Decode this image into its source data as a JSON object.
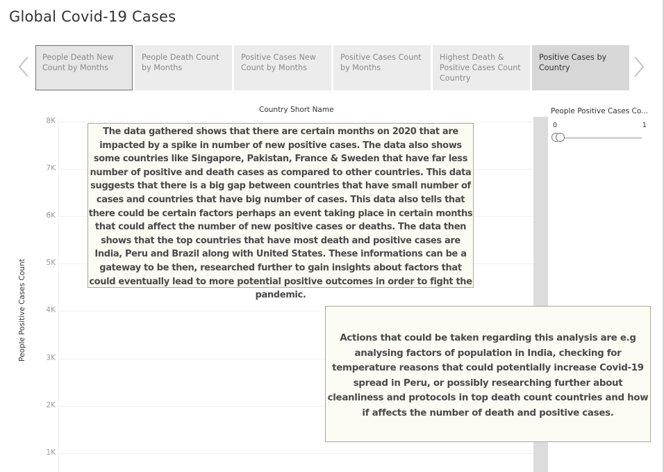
{
  "dashboard": {
    "title": "Global Covid-19 Cases"
  },
  "tabs": [
    {
      "label": "People Death New Count by Months",
      "state": "outlined"
    },
    {
      "label": "People Death Count by Months",
      "state": "normal"
    },
    {
      "label": "Positive Cases New Count by Months",
      "state": "normal"
    },
    {
      "label": "Positive Cases Count by Months",
      "state": "normal"
    },
    {
      "label": "Highest Death & Positive Cases Count Country",
      "state": "normal"
    },
    {
      "label": "Positive Cases by Country",
      "state": "selected"
    }
  ],
  "nav": {
    "prev_icon": "chevron-left-icon",
    "next_icon": "chevron-right-icon"
  },
  "filter": {
    "title": "People Positive Cases Co...",
    "min_label": "0",
    "max_label": "1",
    "range": [
      0,
      0
    ]
  },
  "chart_data": {
    "type": "bar",
    "column_header": "Country Short Name",
    "ylabel": "People Positive Cases Count",
    "ylim": [
      0,
      8000
    ],
    "y_ticks": [
      {
        "value": 8000,
        "label": "8K"
      },
      {
        "value": 7000,
        "label": "7K"
      },
      {
        "value": 6000,
        "label": "6K"
      },
      {
        "value": 5000,
        "label": "5K"
      },
      {
        "value": 4000,
        "label": "4K"
      },
      {
        "value": 3000,
        "label": "3K"
      },
      {
        "value": 2000,
        "label": "2K"
      },
      {
        "value": 1000,
        "label": "1K"
      }
    ],
    "categories": [],
    "values": [],
    "grid": true
  },
  "annotations": [
    "The data gathered shows that there are certain months on 2020 that are impacted by a spike in number of new positive cases. The data also shows some countries like Singapore, Pakistan, France & Sweden that have far less number of positive and death cases as compared to other countries. This data suggests that there is a big gap between countries that have small number of cases and countries that have big number of cases. This data also tells that there could be certain factors perhaps an event taking place in certain months that could affect the number of new positive cases or deaths. The data then shows that the top countries that have most death and positive cases are India, Peru and Brazil along with United States. These informations can be a gateway to be then, researched further to gain insights about factors that could eventually lead to more potential positive outcomes in order to fight the pandemic.",
    "Actions that could be taken regarding this analysis are e.g analysing factors of population in India, checking for temperature reasons that could potentially increase Covid-19 spread in Peru, or possibly researching further about cleanliness and protocols in top death count countries and how if affects the number of death and positive cases."
  ],
  "colors": {
    "selected_tab": "#d7d7d7",
    "tab": "#ececec",
    "annotation_bg": "#fcfcf4",
    "annotation_border": "#a8a89a"
  }
}
